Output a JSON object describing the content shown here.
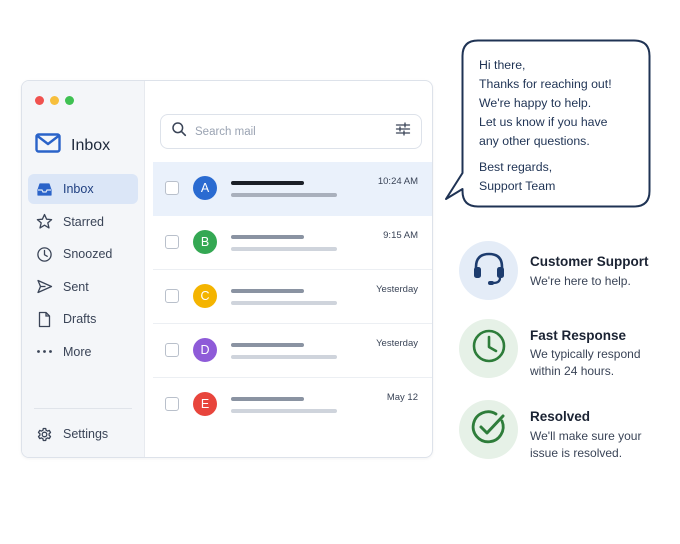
{
  "window": {
    "title": "Inbox",
    "sidebar": {
      "items": [
        {
          "label": "Inbox",
          "icon": "inbox-icon",
          "active": true
        },
        {
          "label": "Starred",
          "icon": "star-icon",
          "active": false
        },
        {
          "label": "Snoozed",
          "icon": "clock-icon",
          "active": false
        },
        {
          "label": "Sent",
          "icon": "send-icon",
          "active": false
        },
        {
          "label": "Drafts",
          "icon": "document-icon",
          "active": false
        },
        {
          "label": "More",
          "icon": "more-dots-icon",
          "active": false
        }
      ],
      "settings_label": "Settings"
    },
    "search": {
      "placeholder": "Search mail"
    },
    "emails": [
      {
        "letter": "A",
        "color": "#2a6bd1",
        "time": "10:24 AM",
        "selected": true
      },
      {
        "letter": "B",
        "color": "#34a853",
        "time": "9:15 AM",
        "selected": false
      },
      {
        "letter": "C",
        "color": "#f4b400",
        "time": "Yesterday",
        "selected": false
      },
      {
        "letter": "D",
        "color": "#8e5bd8",
        "time": "Yesterday",
        "selected": false
      },
      {
        "letter": "E",
        "color": "#e8453c",
        "time": "May 12",
        "selected": false
      }
    ]
  },
  "bubble": {
    "lines": [
      "Hi there,",
      "Thanks for reaching out!",
      "We're happy to help.",
      "Let us know if you have",
      "any other questions."
    ],
    "signoff": [
      "Best regards,",
      "Support Team"
    ]
  },
  "features": [
    {
      "title": "Customer Support",
      "desc": [
        "We're here to help."
      ],
      "icon": "headset-icon",
      "color": "#1d3c6e",
      "bg": "#e4ecf7"
    },
    {
      "title": "Fast Response",
      "desc": [
        "We typically respond",
        "within 24 hours."
      ],
      "icon": "clock-icon",
      "color": "#2e7d3a",
      "bg": "#e6f1e7"
    },
    {
      "title": "Resolved",
      "desc": [
        "We'll make sure your",
        "issue is resolved."
      ],
      "icon": "checkmark-circle-icon",
      "color": "#2e7d3a",
      "bg": "#e6f1e7"
    }
  ]
}
